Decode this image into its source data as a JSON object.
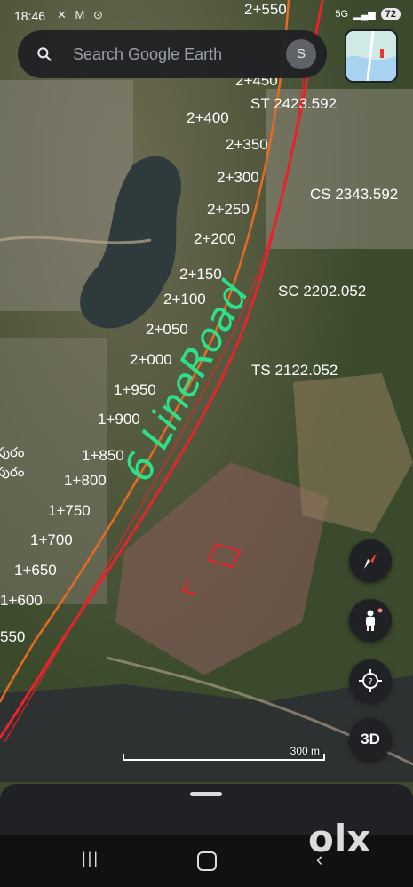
{
  "status_bar": {
    "time": "18:46",
    "icons": "✕ M ⊙",
    "signal": "5G",
    "battery": "72"
  },
  "search": {
    "placeholder": "Search Google Earth",
    "avatar_letter": "S"
  },
  "controls": {
    "view_3d": "3D"
  },
  "map": {
    "chainages": [
      "2+550",
      "2+450",
      "2+400",
      "2+350",
      "2+300",
      "2+250",
      "2+200",
      "2+150",
      "2+100",
      "2+050",
      "2+000",
      "1+950",
      "1+900",
      "1+850",
      "1+800",
      "1+750",
      "1+700",
      "1+650",
      "1+600",
      "550"
    ],
    "curve_labels": [
      "ST 2423.592",
      "CS 2343.592",
      "SC 2202.052",
      "TS 2122.052"
    ],
    "handwritten_note": "6 LineRoad",
    "place_label_line1": "పురం",
    "place_label_line2": "పురం",
    "colors": {
      "alignment_red": "#e8232b",
      "alignment_orange": "#e86a20",
      "note_green": "#2fe08a"
    }
  },
  "scale": {
    "label": "300 m"
  },
  "watermark": {
    "brand": "OLX"
  }
}
